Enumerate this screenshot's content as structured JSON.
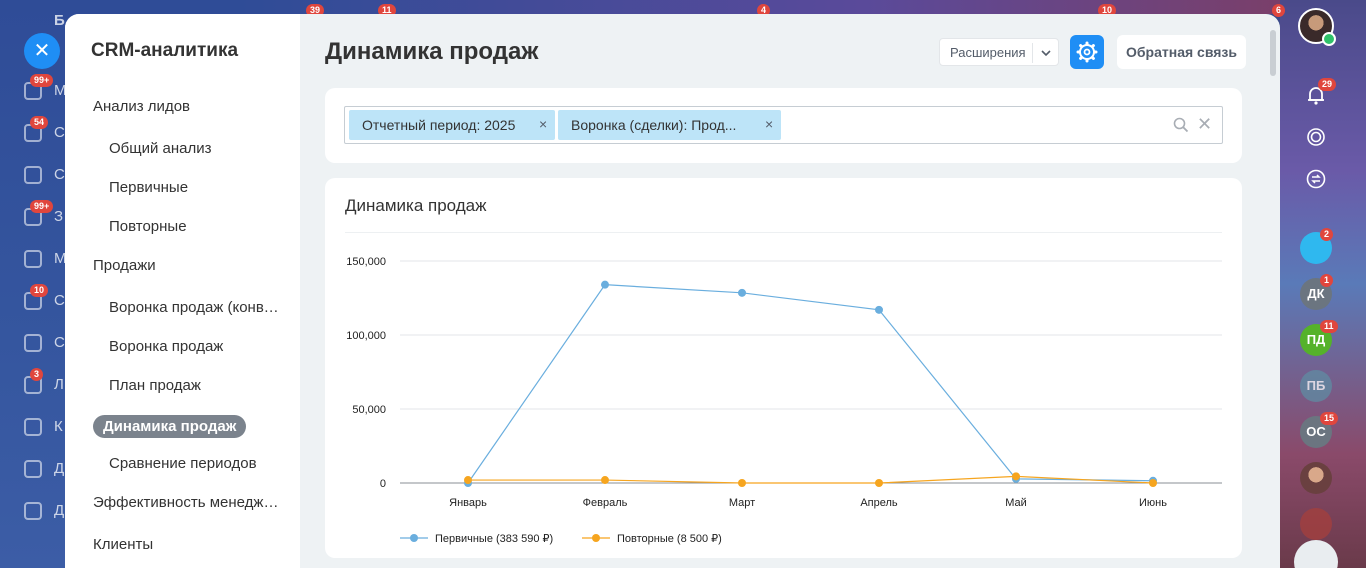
{
  "sidebar_bg": {
    "items": [
      {
        "badge": "99+",
        "label": "М"
      },
      {
        "badge": "54",
        "label": "С"
      },
      {
        "badge": "",
        "label": "С"
      },
      {
        "badge": "99+",
        "label": "З"
      },
      {
        "badge": "",
        "label": "М"
      },
      {
        "badge": "10",
        "label": "С"
      },
      {
        "badge": "",
        "label": "С"
      },
      {
        "badge": "3",
        "label": "Л"
      },
      {
        "badge": "",
        "label": "К"
      },
      {
        "badge": "",
        "label": "Д"
      },
      {
        "badge": "",
        "label": "Д"
      }
    ],
    "top_letter": "Б",
    "close_symbol": "✕"
  },
  "top_badges": [
    "39",
    "11",
    "4",
    "10",
    "6"
  ],
  "menu": {
    "title": "CRM-аналитика",
    "items": [
      {
        "label": "Анализ лидов",
        "level": "top"
      },
      {
        "label": "Общий анализ",
        "level": "sub"
      },
      {
        "label": "Первичные",
        "level": "sub"
      },
      {
        "label": "Повторные",
        "level": "sub"
      },
      {
        "label": "Продажи",
        "level": "top"
      },
      {
        "label": "Воронка продаж (конверсия)",
        "level": "sub"
      },
      {
        "label": "Воронка продаж",
        "level": "sub"
      },
      {
        "label": "План продаж",
        "level": "sub"
      },
      {
        "label": "Динамика продаж",
        "level": "active"
      },
      {
        "label": "Сравнение периодов",
        "level": "sub"
      },
      {
        "label": "Эффективность менеджеров",
        "level": "top"
      },
      {
        "label": "Клиенты",
        "level": "top"
      }
    ]
  },
  "header": {
    "title": "Динамика продаж",
    "extensions_label": "Расширения",
    "feedback_label": "Обратная связь"
  },
  "filter": {
    "chips": [
      {
        "label": "Отчетный период: 2025"
      },
      {
        "label": "Воронка (сделки): Прод..."
      }
    ]
  },
  "chart_title": "Динамика продаж",
  "chart_data": {
    "type": "line",
    "categories": [
      "Январь",
      "Февраль",
      "Март",
      "Апрель",
      "Май",
      "Июнь"
    ],
    "series": [
      {
        "name": "Первичные (383 590 ₽)",
        "color": "#6aaede",
        "values": [
          0,
          134000,
          128500,
          117000,
          2800,
          1500
        ]
      },
      {
        "name": "Повторные (8 500 ₽)",
        "color": "#f6a51f",
        "values": [
          2000,
          2000,
          0,
          0,
          4500,
          0
        ]
      }
    ],
    "y_ticks": [
      "0",
      "50,000",
      "100,000",
      "150,000"
    ],
    "ylim": [
      0,
      150000
    ],
    "grid": true,
    "legend": "bottom-left"
  },
  "right_bar": {
    "notification_badge": "29",
    "chat_badge": "2",
    "avatars": [
      {
        "initials": "ДК",
        "badge": "1",
        "color": "#6b7580"
      },
      {
        "initials": "ПД",
        "badge": "11",
        "color": "#55b22a"
      },
      {
        "initials": "ПБ",
        "badge": "",
        "color": "#5f8ca3"
      },
      {
        "initials": "ОС",
        "badge": "15",
        "color": "#6b7580"
      }
    ]
  }
}
